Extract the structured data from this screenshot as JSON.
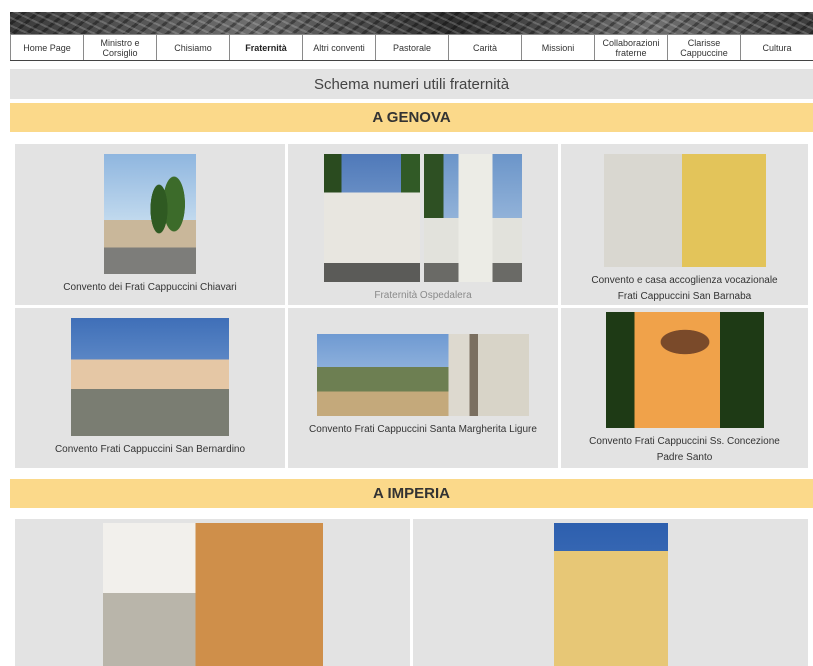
{
  "nav": {
    "items": [
      {
        "label": "Home Page",
        "active": false
      },
      {
        "label": "Ministro e\nCorsiglio",
        "active": false
      },
      {
        "label": "Chisiamo",
        "active": false
      },
      {
        "label": "Fraternità",
        "active": true
      },
      {
        "label": "Altri conventi",
        "active": false
      },
      {
        "label": "Pastorale",
        "active": false
      },
      {
        "label": "Carità",
        "active": false
      },
      {
        "label": "Missioni",
        "active": false
      },
      {
        "label": "Collaborazioni\nfraterne",
        "active": false
      },
      {
        "label": "Clarisse\nCappuccine",
        "active": false
      },
      {
        "label": "Cultura",
        "active": false
      }
    ]
  },
  "page_title": "Schema numeri utili fraternità",
  "sections": {
    "genova": {
      "title": "A GENOVA",
      "cards": [
        {
          "caption": "Convento dei Frati Cappuccini  Chiavari"
        },
        {
          "caption": "Fraternità Ospedalera"
        },
        {
          "caption_line1": "Convento e casa accoglienza vocazionale",
          "caption_line2": "Frati Cappuccini San Barnaba"
        },
        {
          "caption": "Convento Frati Cappuccini San Bernardino"
        },
        {
          "caption": "Convento Frati Cappuccini Santa Margherita Ligure"
        },
        {
          "caption_line1": "Convento Frati Cappuccini Ss. Concezione",
          "caption_line2": "Padre Santo"
        }
      ]
    },
    "imperia": {
      "title": "A IMPERIA"
    }
  },
  "colors": {
    "section_bar": "#fbd98a",
    "title_bar": "#e3e3e3",
    "card_bg": "#e3e3e3"
  }
}
